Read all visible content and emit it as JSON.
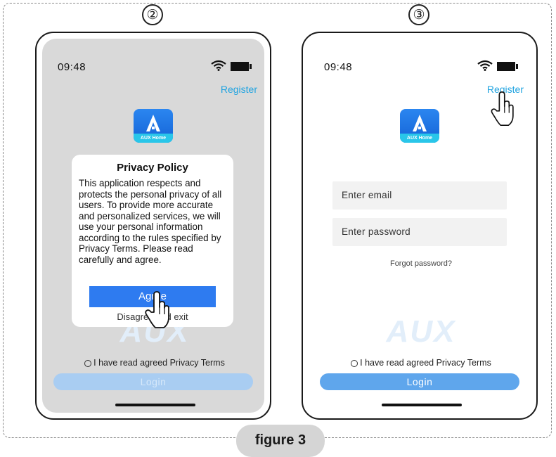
{
  "steps": [
    "②",
    "③"
  ],
  "caption": "figure 3",
  "colors": {
    "accent": "#1fa3e0",
    "agree": "#2e7bf0",
    "login_active": "#5fa6ec",
    "login_disabled": "#a9cdf2"
  },
  "phone2": {
    "time": "09:48",
    "register": "Register",
    "app_brand": "AUX Home",
    "dialog": {
      "title": "Privacy Policy",
      "body": "This application respects and protects the personal privacy of all users. To provide more accurate and personalized services, we will use your personal information according to the rules specified by Privacy Terms. Please read carefully and agree.",
      "agree": "Agree",
      "disagree": "Disagree and exit"
    },
    "watermark": "AUX",
    "terms": "I have read agreed Privacy Terms",
    "login": "Login"
  },
  "phone3": {
    "time": "09:48",
    "register": "Register",
    "app_brand": "AUX Home",
    "email_placeholder": "Enter email",
    "password_placeholder": "Enter password",
    "forgot": "Forgot password?",
    "watermark": "AUX",
    "terms": "I have read agreed Privacy Terms",
    "login": "Login"
  }
}
